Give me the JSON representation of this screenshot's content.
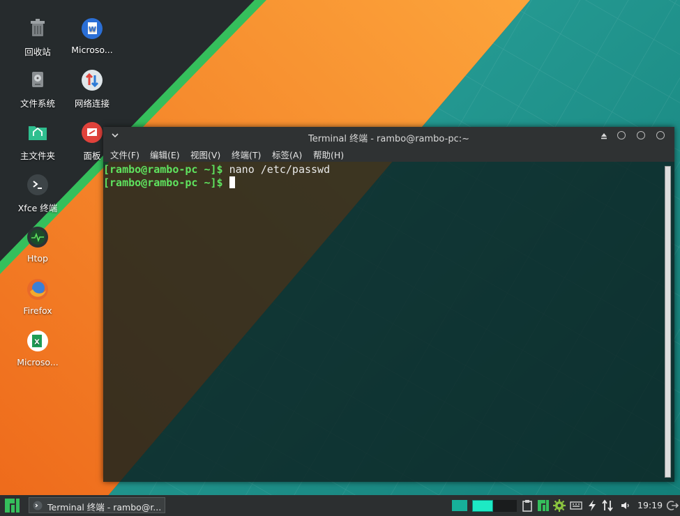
{
  "desktop": {
    "icons": [
      {
        "label": "回收站",
        "icon": "trash-icon"
      },
      {
        "label": "Microso...",
        "icon": "word-doc-icon"
      },
      {
        "label": "文件系统",
        "icon": "filesystem-icon"
      },
      {
        "label": "网络连接",
        "icon": "network-icon"
      },
      {
        "label": "主文件夹",
        "icon": "home-folder-icon"
      },
      {
        "label": "面板",
        "icon": "panel-icon"
      },
      {
        "label": "Xfce 终端",
        "icon": "terminal-icon"
      },
      {
        "label": "Htop",
        "icon": "htop-icon"
      },
      {
        "label": "Firefox",
        "icon": "firefox-icon"
      },
      {
        "label": "Microso...",
        "icon": "excel-icon"
      }
    ]
  },
  "terminal": {
    "title": "Terminal 终端 - rambo@rambo-pc:~",
    "menu": [
      "文件(F)",
      "编辑(E)",
      "视图(V)",
      "终端(T)",
      "标签(A)",
      "帮助(H)"
    ],
    "lines": [
      {
        "prompt": "[rambo@rambo-pc ~]$",
        "command": " nano /etc/passwd"
      },
      {
        "prompt": "[rambo@rambo-pc ~]$",
        "command": " "
      }
    ]
  },
  "taskbar": {
    "task_label": "Terminal 终端 - rambo@r...",
    "clock": "19:19"
  },
  "colors": {
    "accent_green": "#35bf5c",
    "wallpaper_orange": "#f5841f",
    "wallpaper_teal": "#16a085",
    "prompt_green": "#5fe35f"
  }
}
